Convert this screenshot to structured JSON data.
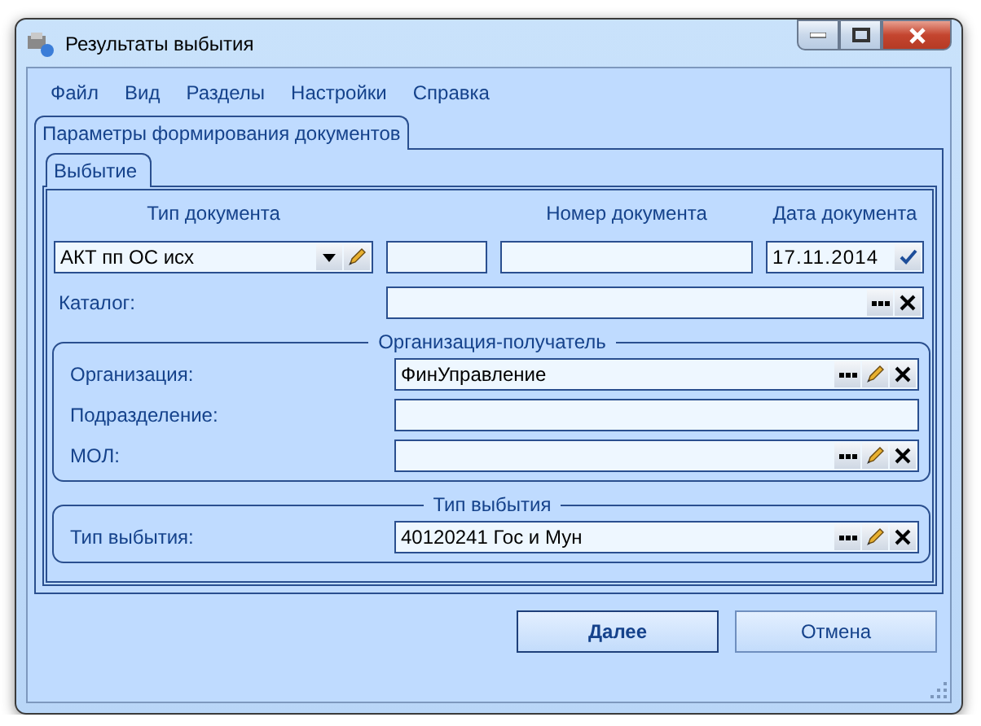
{
  "window": {
    "title": "Результаты выбытия"
  },
  "menu": [
    "Файл",
    "Вид",
    "Разделы",
    "Настройки",
    "Справка"
  ],
  "tabs": [
    {
      "label": "Параметры формирования документов",
      "selected": true
    }
  ],
  "subtabs": [
    {
      "label": "Выбытие",
      "selected": true
    }
  ],
  "document": {
    "headers": [
      "Тип документа",
      "Номер документа",
      "Дата документа"
    ],
    "fields": [
      {
        "kind": "combo",
        "value": "АКТ пп ОС исх",
        "buttons": [
          {
            "kind": "dropdown"
          },
          {
            "kind": "edit"
          }
        ]
      },
      {
        "kind": "text"
      },
      {
        "kind": "number"
      },
      {
        "kind": "date",
        "value": "17.11.2014",
        "buttons": [
          {
            "kind": "confirm"
          }
        ]
      }
    ],
    "catalog": {
      "label": "Каталог:",
      "buttons": [
        {
          "kind": "browse"
        },
        {
          "kind": "clear"
        }
      ]
    }
  },
  "groups": [
    {
      "title": "Организация-получатель",
      "rows": [
        {
          "label": "Организация:",
          "value": "ФинУправление",
          "buttons": [
            {
              "kind": "browse"
            },
            {
              "kind": "edit"
            },
            {
              "kind": "clear"
            }
          ]
        },
        {
          "label": "Подразделение:"
        },
        {
          "label": "МОЛ:",
          "buttons": [
            {
              "kind": "browse"
            },
            {
              "kind": "edit"
            },
            {
              "kind": "clear"
            }
          ]
        }
      ]
    },
    {
      "title": "Тип выбытия",
      "rows": [
        {
          "label": "Тип выбытия:",
          "value": "40120241 Гос и Мун",
          "buttons": [
            {
              "kind": "browse"
            },
            {
              "kind": "edit"
            },
            {
              "kind": "clear"
            }
          ]
        }
      ]
    }
  ],
  "buttons": [
    {
      "label": "Далее",
      "default": true
    },
    {
      "label": "Отмена",
      "default": false
    }
  ]
}
